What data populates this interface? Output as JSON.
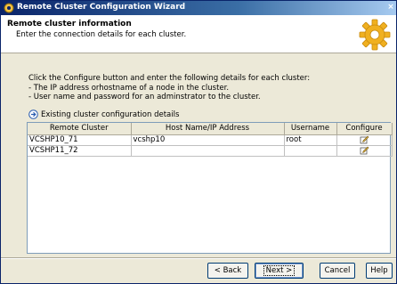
{
  "window": {
    "title": "Remote Cluster Configuration Wizard",
    "close_glyph": "×"
  },
  "header": {
    "title": "Remote cluster information",
    "subtitle": "Enter the connection details for each cluster."
  },
  "instructions": [
    "Click the Configure button and enter the following details for each cluster:",
    "- The IP address orhostname of a node in the cluster.",
    "- User name and password for an adminstrator to the cluster."
  ],
  "existing_section": {
    "label": "Existing cluster configuration details",
    "icon": "expand-arrow-icon"
  },
  "table": {
    "columns": [
      "Remote Cluster",
      "Host Name/IP Address",
      "Username",
      "Configure"
    ],
    "rows": [
      {
        "cluster": "VCSHP10_71",
        "host": "vcshp10",
        "username": "root",
        "configure_icon": "edit-icon"
      },
      {
        "cluster": "VCSHP11_72",
        "host": "",
        "username": "",
        "configure_icon": "edit-icon"
      }
    ]
  },
  "buttons": {
    "back": "< Back",
    "next": "Next >",
    "cancel": "Cancel",
    "help": "Help"
  },
  "colors": {
    "titlebar": "#0a246a",
    "dialog_bg": "#ece9d8",
    "accent_gear": "#f0b020"
  }
}
